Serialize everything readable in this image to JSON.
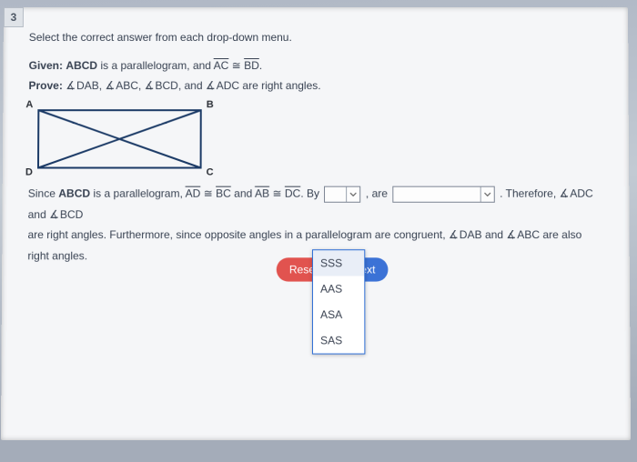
{
  "question_number": "3",
  "instruction": "Select the correct answer from each drop-down menu.",
  "given_label": "Given:",
  "given_text_a": "ABCD",
  "given_text_b": " is a parallelogram, and ",
  "given_seg1": "AC",
  "given_cong": " ≅ ",
  "given_seg2": "BD",
  "prove_label": "Prove:",
  "prove_ang1": "DAB",
  "prove_ang2": "ABC",
  "prove_ang3": "BCD",
  "prove_mid": ", and ",
  "prove_ang4": "ADC",
  "prove_end": " are right angles.",
  "labels": {
    "A": "A",
    "B": "B",
    "C": "C",
    "D": "D"
  },
  "proof": {
    "p1a": "Since ",
    "p1b": "ABCD",
    "p1c": " is a parallelogram, ",
    "seg_ad": "AD",
    "cong": " ≅ ",
    "seg_bc": "BC",
    "and1": " and ",
    "seg_ab": "AB",
    "seg_dc": "DC",
    "by": ". By ",
    "are": " , are ",
    "therefore": " . Therefore, ",
    "ang_adc": "ADC",
    "and2": " and ",
    "ang_bcd": "BCD",
    "line2a": "are right angles. Furthermore, since opposite angles in a parallelogram are ",
    "line2b": "congruent, ",
    "ang_dab": "DAB",
    "and3": " and ",
    "ang_abc": "ABC",
    "line2c": " are also right angles."
  },
  "buttons": {
    "reset": "Reset",
    "next": "Next"
  },
  "dropdown": {
    "options": [
      "SSS",
      "AAS",
      "ASA",
      "SAS"
    ],
    "selected": "SSS"
  }
}
